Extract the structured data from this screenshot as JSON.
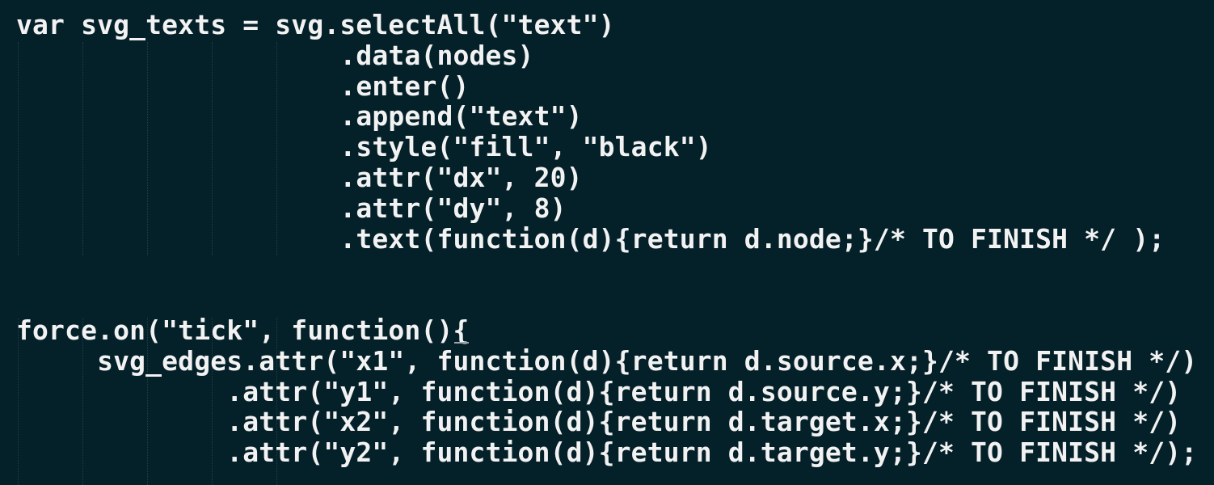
{
  "editor": {
    "theme": {
      "background": "#042029",
      "text": "#f2f2f2",
      "indent_guide": "#8caab4"
    },
    "lines": [
      "var svg_texts = svg.selectAll(\"text\")",
      "                    .data(nodes)",
      "                    .enter()",
      "                    .append(\"text\")",
      "                    .style(\"fill\", \"black\")",
      "                    .attr(\"dx\", 20)",
      "                    .attr(\"dy\", 8)",
      "                    .text(function(d){return d.node;}/* TO FINISH */ );",
      "",
      "",
      "force.on(\"tick\", function(){",
      "     svg_edges.attr(\"x1\", function(d){return d.source.x;}/* TO FINISH */)",
      "             .attr(\"y1\", function(d){return d.source.y;}/* TO FINISH */)",
      "             .attr(\"x2\", function(d){return d.target.x;}/* TO FINISH */)",
      "             .attr(\"y2\", function(d){return d.target.y;}/* TO FINISH */);"
    ]
  }
}
